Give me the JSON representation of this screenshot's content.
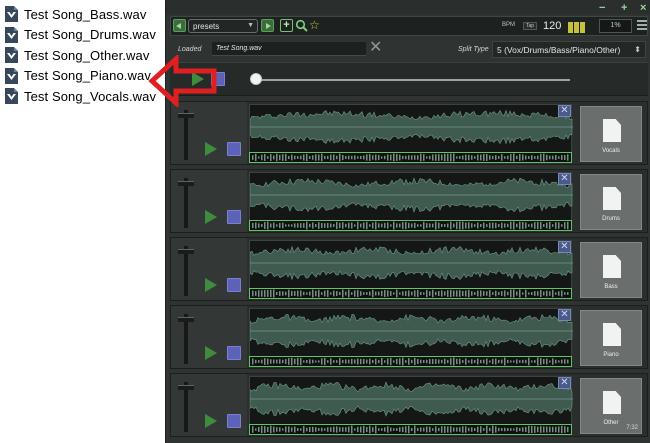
{
  "file_list": [
    {
      "name": "Test Song_Bass.wav"
    },
    {
      "name": "Test Song_Drums.wav"
    },
    {
      "name": "Test Song_Other.wav"
    },
    {
      "name": "Test Song_Piano.wav"
    },
    {
      "name": "Test Song_Vocals.wav"
    }
  ],
  "window": {
    "min": "−",
    "max": "+",
    "close": "×"
  },
  "toolbar": {
    "presets_value": "presets",
    "plus": "+",
    "star": "☆",
    "bpm_label": "BPM",
    "tap_label": "Tap",
    "bpm_value": "120",
    "pct_value": "1%"
  },
  "loaded": {
    "label": "Loaded",
    "value": "Test Song.wav",
    "clear": "✕"
  },
  "split": {
    "label": "Split Type",
    "value": "5 (Vox/Drums/Bass/Piano/Other)"
  },
  "master": {
    "position": 0.0
  },
  "tracks": [
    {
      "name": "Vocals",
      "close": "✕",
      "time": ""
    },
    {
      "name": "Drums",
      "close": "✕",
      "time": ""
    },
    {
      "name": "Bass",
      "close": "✕",
      "time": ""
    },
    {
      "name": "Piano",
      "close": "✕",
      "time": ""
    },
    {
      "name": "Other",
      "close": "✕",
      "time": "7:32"
    }
  ],
  "icons": {
    "file": "wav-file-icon",
    "arrow": "red-arrow-icon",
    "play": "play-icon",
    "stop": "stop-icon",
    "search": "search-icon",
    "menu": "hamburger-icon",
    "doc": "document-icon"
  },
  "colors": {
    "accent_green": "#5fc65f",
    "stop_blue": "#5c62b8",
    "arrow_red": "#e02020",
    "app_bg": "#2f3432"
  }
}
